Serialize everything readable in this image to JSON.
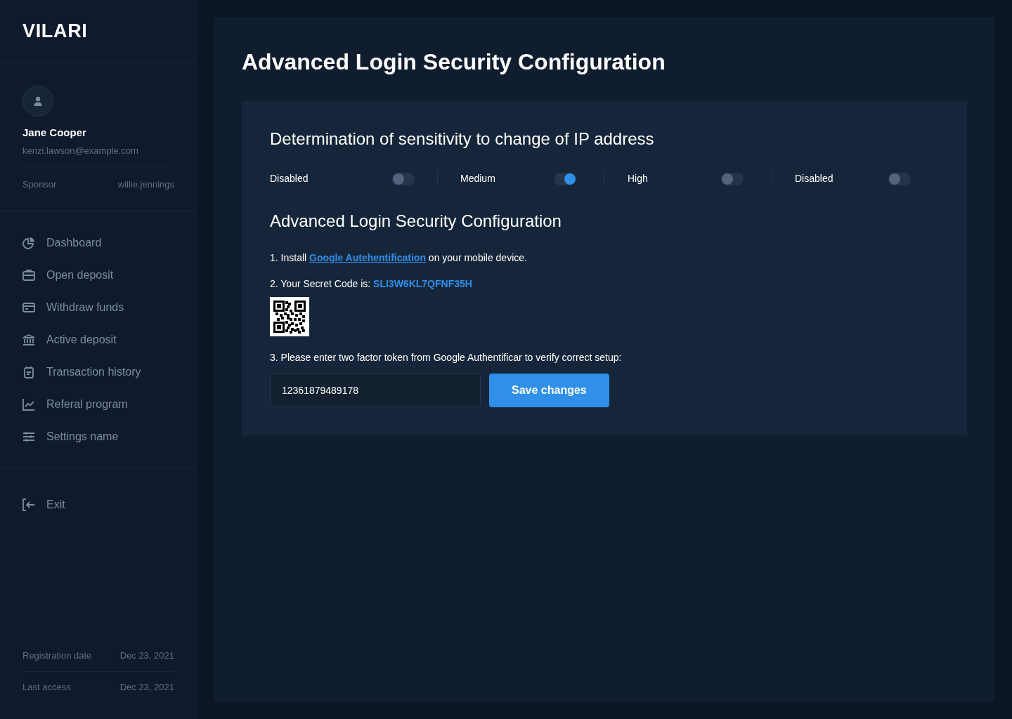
{
  "logo": "VILARI",
  "user": {
    "name": "Jane Cooper",
    "email": "kenzi.lawson@example.com",
    "sponsor_label": "Sponsor",
    "sponsor": "willie.jennings"
  },
  "nav": [
    {
      "label": "Dashboard"
    },
    {
      "label": "Open deposit"
    },
    {
      "label": "Withdraw funds"
    },
    {
      "label": "Active deposit"
    },
    {
      "label": "Transaction history"
    },
    {
      "label": "Referal program"
    },
    {
      "label": "Settings name"
    }
  ],
  "exit": "Exit",
  "meta": [
    {
      "label": "Registration date",
      "value": "Dec 23, 2021"
    },
    {
      "label": "Last access",
      "value": "Dec 23, 2021"
    }
  ],
  "page_title": "Advanced Login Security Configuration",
  "sensitivity": {
    "title": "Determination of sensitivity to change of IP address",
    "options": [
      {
        "label": "Disabled",
        "on": false
      },
      {
        "label": "Medium",
        "on": true
      },
      {
        "label": "High",
        "on": false
      },
      {
        "label": "Disabled",
        "on": false
      }
    ]
  },
  "setup": {
    "title": "Advanced Login Security Configuration",
    "step1": {
      "before": "1. Install",
      "link": "Google Autehentification",
      "after": "on your mobile device."
    },
    "step2": {
      "text": "2. Your Secret Code is:",
      "code": "SLI3W6KL7QFNF35H"
    },
    "step3": "3. Please enter two factor token from Google Authentificar to verify correct setup:",
    "token": "12361879489178",
    "save": "Save changes"
  }
}
